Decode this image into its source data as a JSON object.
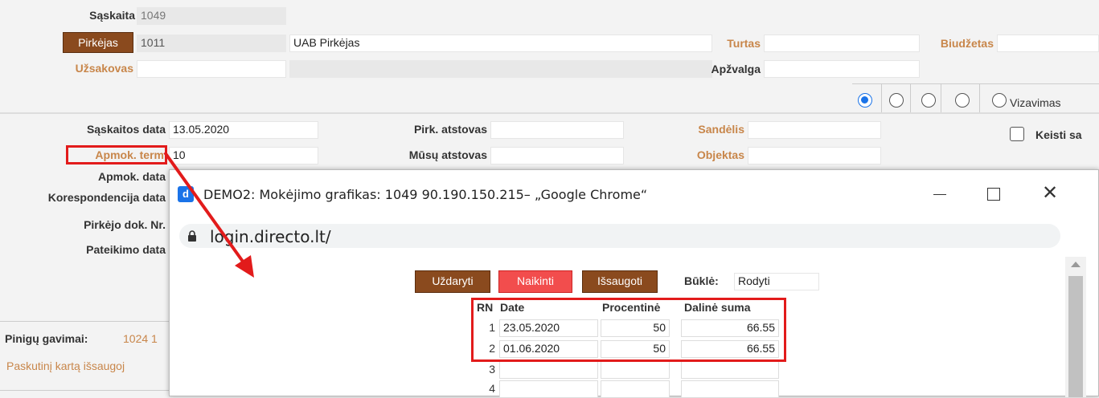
{
  "form": {
    "saskaita_label": "Sąskaita",
    "saskaita_value": "1049",
    "pirkejas_button": "Pirkėjas",
    "pirkejas_code": "1011",
    "pirkejas_name": "UAB Pirkėjas",
    "turtas_label": "Turtas",
    "biudzetas_label": "Biudžetas",
    "uzsakovas_label": "Užsakovas",
    "apzvalga_label": "Apžvalga",
    "vizavimas_label": "Vizavimas"
  },
  "details": {
    "saskaitos_data_label": "Sąskaitos data",
    "saskaitos_data_value": "13.05.2020",
    "pirk_atstovas_label": "Pirk. atstovas",
    "sandelis_label": "Sandėlis",
    "keisti_label": "Keisti sa",
    "apmok_term_label": "Apmok. term",
    "apmok_term_value": "10",
    "musu_atstovas_label": "Mūsų atstovas",
    "objektas_label": "Objektas",
    "apmok_data_label": "Apmok. data",
    "korespondencija_label": "Korespondencija data",
    "pirkejo_dok_label": "Pirkėjo dok. Nr.",
    "pateikimo_label": "Pateikimo data",
    "pinigu_label": "Pinigų gavimai:",
    "pinigu_value": "1024 1",
    "paskutini_label": "Paskutinį kartą išsaugoj"
  },
  "popup": {
    "title": "DEMO2: Mokėjimo grafikas: 1049 90.190.150.215– „Google Chrome“",
    "url": "login.directo.lt/",
    "close_button": "Uždaryti",
    "delete_button": "Naikinti",
    "save_button": "Išsaugoti",
    "status_label": "Būklė:",
    "status_value": "Rodyti",
    "columns": [
      "RN",
      "Date",
      "Procentinė",
      "Dalinė suma"
    ],
    "rows": [
      {
        "rn": "1",
        "date": "23.05.2020",
        "pct": "50",
        "sum": "66.55"
      },
      {
        "rn": "2",
        "date": "01.06.2020",
        "pct": "50",
        "sum": "66.55"
      },
      {
        "rn": "3",
        "date": "",
        "pct": "",
        "sum": ""
      },
      {
        "rn": "4",
        "date": "",
        "pct": "",
        "sum": ""
      }
    ]
  },
  "colors": {
    "accent_brown": "#8a4a1e",
    "delete_red": "#f24d4d",
    "highlight_red": "#e21b1b",
    "label_orange": "#c8864a"
  }
}
